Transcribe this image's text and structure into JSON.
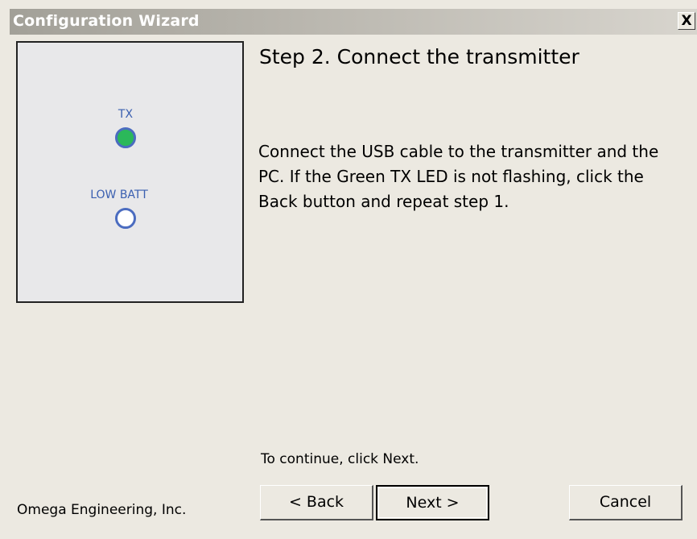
{
  "window": {
    "title": "Configuration Wizard",
    "close_label": "X"
  },
  "led_panel": {
    "tx_label": "TX",
    "tx_state": "on",
    "tx_color": "#2bb85a",
    "low_batt_label": "LOW BATT",
    "low_batt_state": "off"
  },
  "content": {
    "heading": "Step 2.  Connect the transmitter",
    "instructions": "Connect the USB cable to the transmitter and the PC.  If the Green TX LED is not flashing, click the Back button and repeat step 1.",
    "continue_hint": "To continue, click Next."
  },
  "footer": {
    "company": "Omega Engineering, Inc.",
    "back_label": "< Back",
    "next_label": "Next >",
    "cancel_label": "Cancel"
  }
}
